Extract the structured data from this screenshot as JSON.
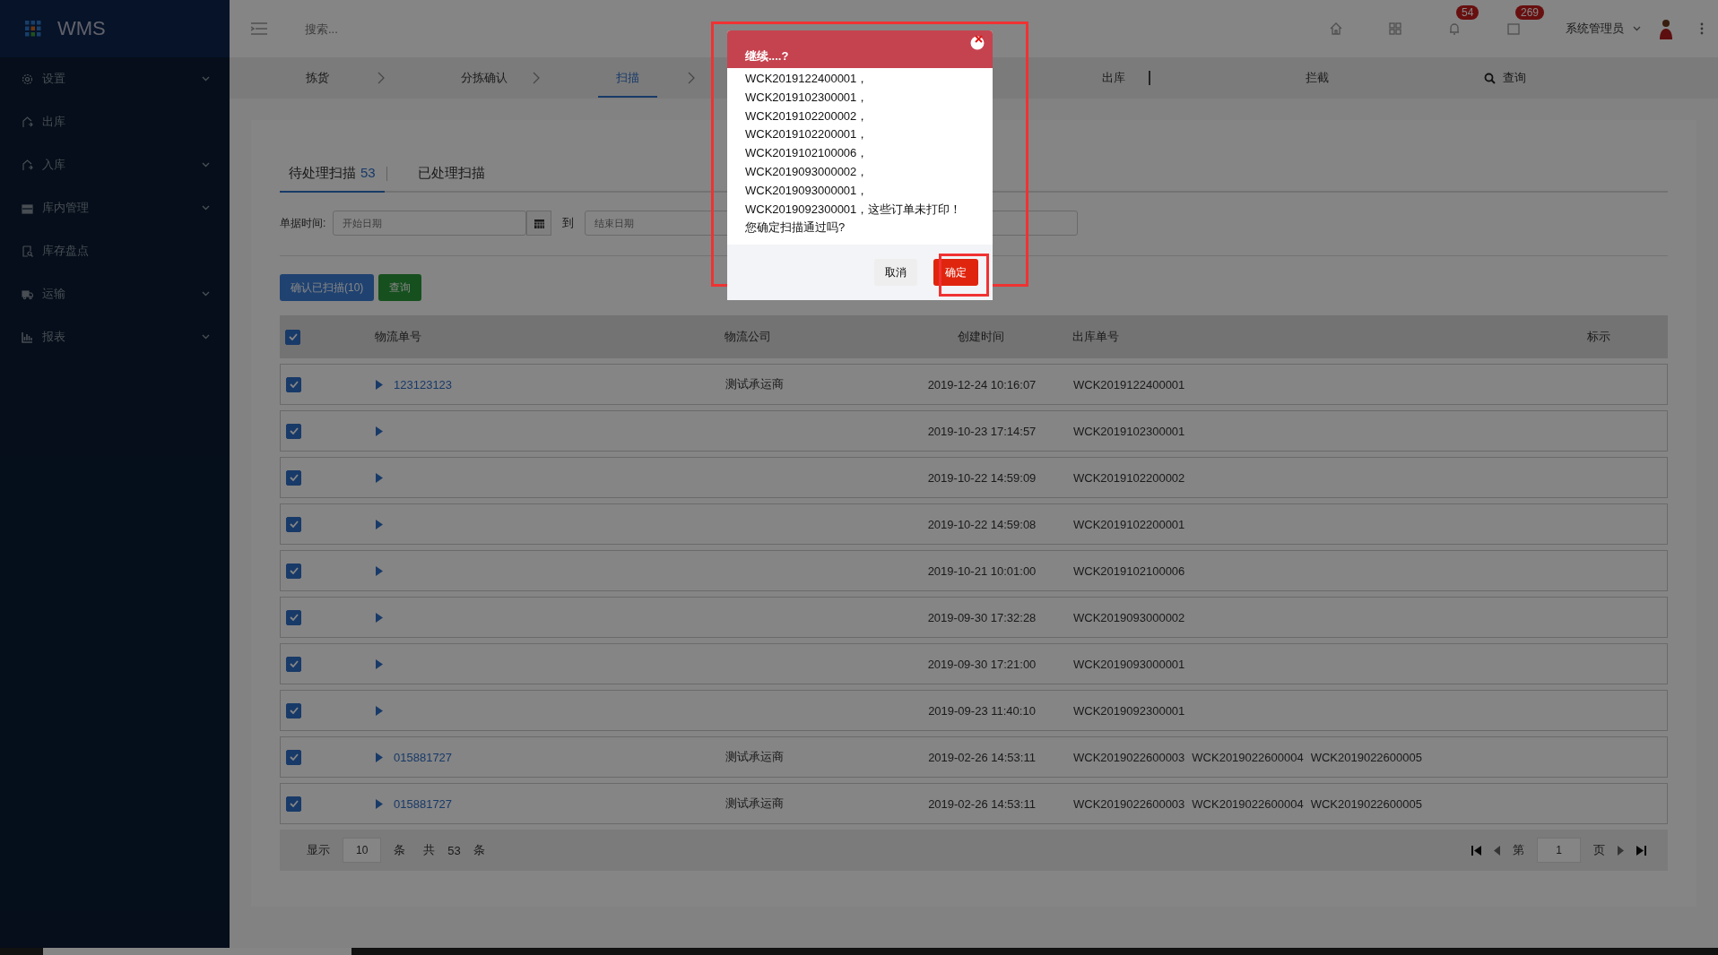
{
  "sidebar": {
    "logo": "WMS",
    "items": [
      {
        "label": "设置",
        "has_children": true
      },
      {
        "label": "出库",
        "has_children": false
      },
      {
        "label": "入库",
        "has_children": true
      },
      {
        "label": "库内管理",
        "has_children": true
      },
      {
        "label": "库存盘点",
        "has_children": false
      },
      {
        "label": "运输",
        "has_children": true
      },
      {
        "label": "报表",
        "has_children": true
      }
    ]
  },
  "topbar": {
    "search_placeholder": "搜索...",
    "badges": [
      "54",
      "269"
    ],
    "user": "系统管理员"
  },
  "steps": [
    {
      "label": "拣货",
      "selected": false,
      "kind": "step"
    },
    {
      "label": "分拣确认",
      "selected": false,
      "kind": "step"
    },
    {
      "label": "扫描",
      "selected": true,
      "kind": "step"
    },
    {
      "label": "出库",
      "selected": false,
      "kind": "plain"
    },
    {
      "label": "拦截",
      "selected": false,
      "kind": "plain"
    },
    {
      "label": "查询",
      "selected": false,
      "kind": "search"
    }
  ],
  "tabs": [
    {
      "label": "待处理扫描",
      "count": "53",
      "selected": true
    },
    {
      "label": "已处理扫描",
      "selected": false
    }
  ],
  "filter": {
    "label": "单据时间:",
    "start_placeholder": "开始日期",
    "to": "到",
    "end_placeholder": "结束日期"
  },
  "buttons": [
    {
      "label": "确认已扫描(10)",
      "kind": "primary"
    },
    {
      "label": "查询",
      "kind": "success"
    }
  ],
  "table": {
    "all_checked": true,
    "columns": [
      "物流单号",
      "物流公司",
      "创建时间",
      "出库单号",
      "标示"
    ],
    "rows": [
      {
        "checked": true,
        "tracking": "123123123",
        "company": "测试承运商",
        "created": "2019-12-24 10:16:07",
        "orders": [
          "WCK2019122400001"
        ]
      },
      {
        "checked": true,
        "created": "2019-10-23 17:14:57",
        "orders": [
          "WCK2019102300001"
        ]
      },
      {
        "checked": true,
        "created": "2019-10-22 14:59:09",
        "orders": [
          "WCK2019102200002"
        ]
      },
      {
        "checked": true,
        "created": "2019-10-22 14:59:08",
        "orders": [
          "WCK2019102200001"
        ]
      },
      {
        "checked": true,
        "created": "2019-10-21 10:01:00",
        "orders": [
          "WCK2019102100006"
        ]
      },
      {
        "checked": true,
        "created": "2019-09-30 17:32:28",
        "orders": [
          "WCK2019093000002"
        ]
      },
      {
        "checked": true,
        "created": "2019-09-30 17:21:00",
        "orders": [
          "WCK2019093000001"
        ]
      },
      {
        "checked": true,
        "created": "2019-09-23 11:40:10",
        "orders": [
          "WCK2019092300001"
        ]
      },
      {
        "checked": true,
        "tracking": "015881727",
        "company": "测试承运商",
        "created": "2019-02-26 14:53:11",
        "orders": [
          "WCK2019022600003",
          "WCK2019022600004",
          "WCK2019022600005"
        ]
      },
      {
        "checked": true,
        "tracking": "015881727",
        "company": "测试承运商",
        "created": "2019-02-26 14:53:11",
        "orders": [
          "WCK2019022600003",
          "WCK2019022600004",
          "WCK2019022600005"
        ]
      }
    ]
  },
  "pagination": {
    "show": "显示",
    "page_size": "10",
    "unit": "条",
    "total_label": "共",
    "total": "53",
    "total_unit": "条",
    "page_label": "第",
    "page": "1",
    "page_unit": "页"
  },
  "dialog": {
    "title": "继续....?",
    "lines": [
      "WCK2019122400001，",
      "WCK2019102300001，",
      "WCK2019102200002，",
      "WCK2019102200001，",
      "WCK2019102100006，",
      "WCK2019093000002，",
      "WCK2019093000001，",
      "WCK2019092300001，这些订单未打印！您确定扫描通过吗?"
    ],
    "cancel": "取消",
    "ok": "确定"
  },
  "highlights": {
    "dialog": true,
    "ok_button": true
  }
}
